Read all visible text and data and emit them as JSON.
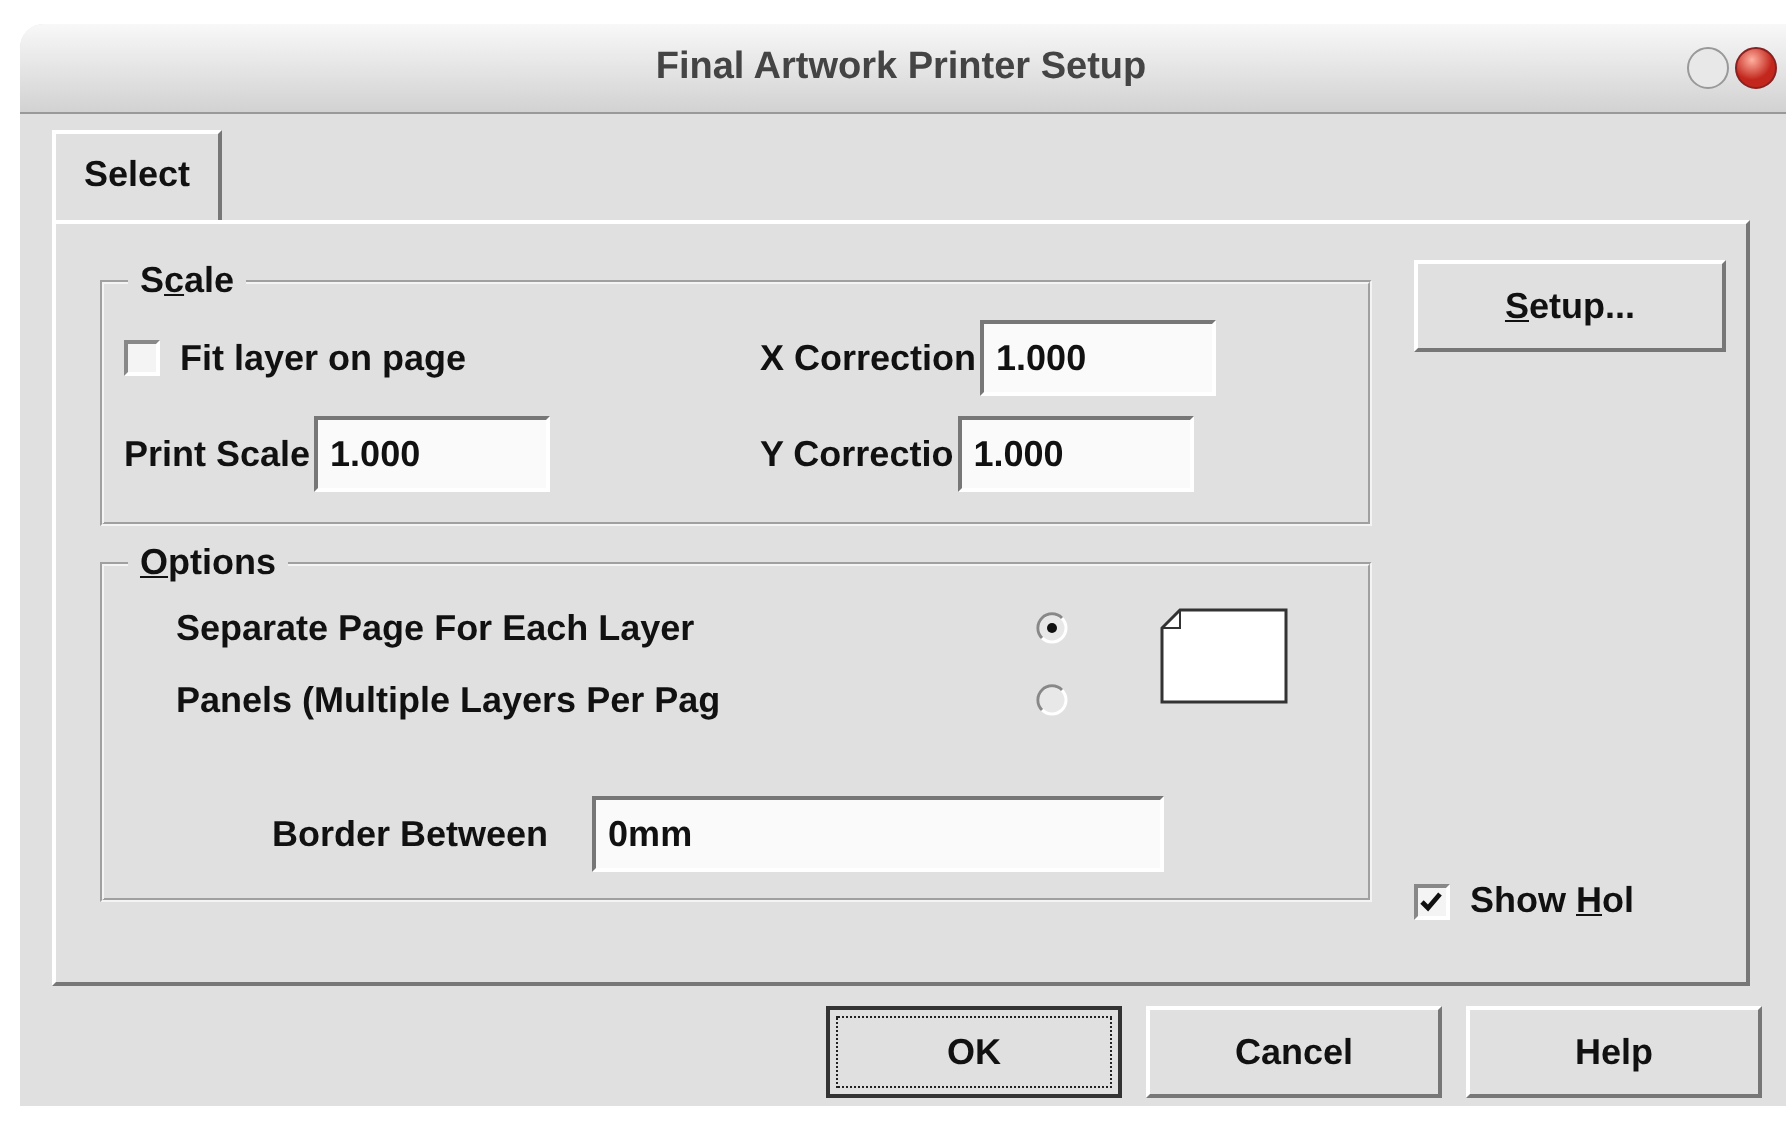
{
  "window": {
    "title": "Final Artwork Printer Setup"
  },
  "tabs": [
    {
      "label": "Select",
      "selected": true
    }
  ],
  "scale": {
    "legend": {
      "pre": "S",
      "key": "c",
      "post": "ale"
    },
    "fit_layer": {
      "label": "Fit layer on page",
      "checked": false
    },
    "print_scale": {
      "label": "Print Scale",
      "value": "1.000"
    },
    "x_correction": {
      "label": "X Correction",
      "value": "1.000"
    },
    "y_correction": {
      "label": "Y Correctio",
      "value": "1.000"
    }
  },
  "options": {
    "legend": {
      "key": "O",
      "post": "ptions"
    },
    "layouts": [
      {
        "label": "Separate Page For Each Layer",
        "selected": true
      },
      {
        "label": "Panels (Multiple Layers Per Pag",
        "selected": false
      }
    ],
    "border_between": {
      "label": "Border Between",
      "value": "0mm"
    }
  },
  "setup_button": {
    "key": "S",
    "post": "etup..."
  },
  "show_holes": {
    "pre": "Show ",
    "key": "H",
    "post": "ol",
    "checked": true
  },
  "buttons": [
    {
      "label": "OK",
      "focused": true
    },
    {
      "label": "Cancel",
      "focused": false
    },
    {
      "label": "Help",
      "focused": false
    }
  ]
}
